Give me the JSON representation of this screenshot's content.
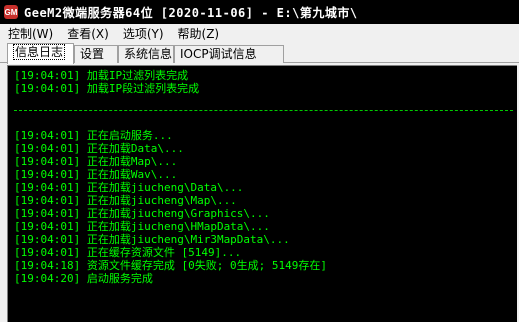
{
  "window": {
    "icon_text": "GM",
    "title": "GeeM2微端服务器64位 [2020-11-06] - E:\\第九城市\\"
  },
  "menu": [
    {
      "label": "控制(W)"
    },
    {
      "label": "查看(X)"
    },
    {
      "label": "选项(Y)"
    },
    {
      "label": "帮助(Z)"
    }
  ],
  "tabs": [
    {
      "label": "信息日志",
      "active": true
    },
    {
      "label": "设置",
      "active": false
    },
    {
      "label": "系统信息",
      "active": false
    },
    {
      "label": "IOCP调试信息",
      "active": false
    }
  ],
  "log": {
    "text_color": "#00ff00",
    "lines": [
      "[19:04:01] 加载IP过滤列表完成",
      "[19:04:01] 加载IP段过滤列表完成",
      "[19:04:01] 正在启动服务...",
      "[19:04:01] 正在加载Data\\...",
      "[19:04:01] 正在加载Map\\...",
      "[19:04:01] 正在加载Wav\\...",
      "[19:04:01] 正在加载jiucheng\\Data\\...",
      "[19:04:01] 正在加载jiucheng\\Map\\...",
      "[19:04:01] 正在加载jiucheng\\Graphics\\...",
      "[19:04:01] 正在加载jiucheng\\HMapData\\...",
      "[19:04:01] 正在加载jiucheng\\Mir3MapData\\...",
      "[19:04:01] 正在缓存资源文件 [5149]...",
      "[19:04:18] 资源文件缓存完成 [0失败; 0生成; 5149存在]",
      "[19:04:20] 启动服务完成"
    ]
  }
}
